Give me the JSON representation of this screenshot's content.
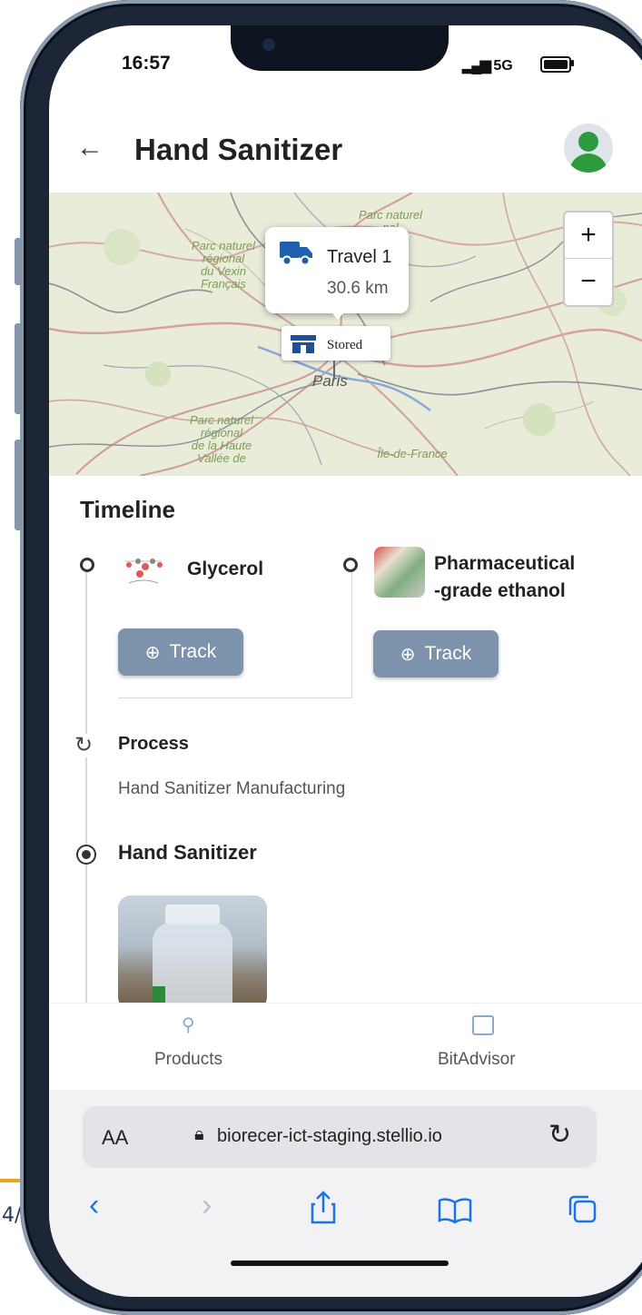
{
  "page_number": "4/",
  "status_bar": {
    "time": "16:57",
    "network": "5G"
  },
  "header": {
    "back_label": "←",
    "title": "Hand Sanitizer"
  },
  "map": {
    "zoom_in": "+",
    "zoom_out": "−",
    "popup": {
      "name": "Travel 1",
      "distance": "30.6 km"
    },
    "stored_label": "Stored",
    "labels": {
      "vexin": "Parc naturel\nrégional\ndu Vexin\nFrançais",
      "parc_top": "Parc naturel\nnal",
      "haute": "Parc naturel\nrégional\nde la Haute\nVallée de",
      "paris": "Paris",
      "idf": "Île-de-France"
    }
  },
  "timeline": {
    "heading": "Timeline",
    "inputs": [
      {
        "name": "Glycerol",
        "button": "Track"
      },
      {
        "name": "Pharmaceutical\n-grade ethanol",
        "button": "Track"
      }
    ],
    "process": {
      "label": "Process",
      "description": "Hand Sanitizer Manufacturing"
    },
    "output": {
      "label": "Hand Sanitizer"
    }
  },
  "bottom_nav": {
    "products": "Products",
    "bitadvisor": "BitAdvisor"
  },
  "browser": {
    "aa": "AA",
    "url": "biorecer-ict-staging.stellio.io"
  },
  "colors": {
    "accent_button": "#7d93ac",
    "avatar_green": "#2e9a3e",
    "safari_blue": "#1a73e8",
    "truck_blue": "#1f5fae"
  }
}
